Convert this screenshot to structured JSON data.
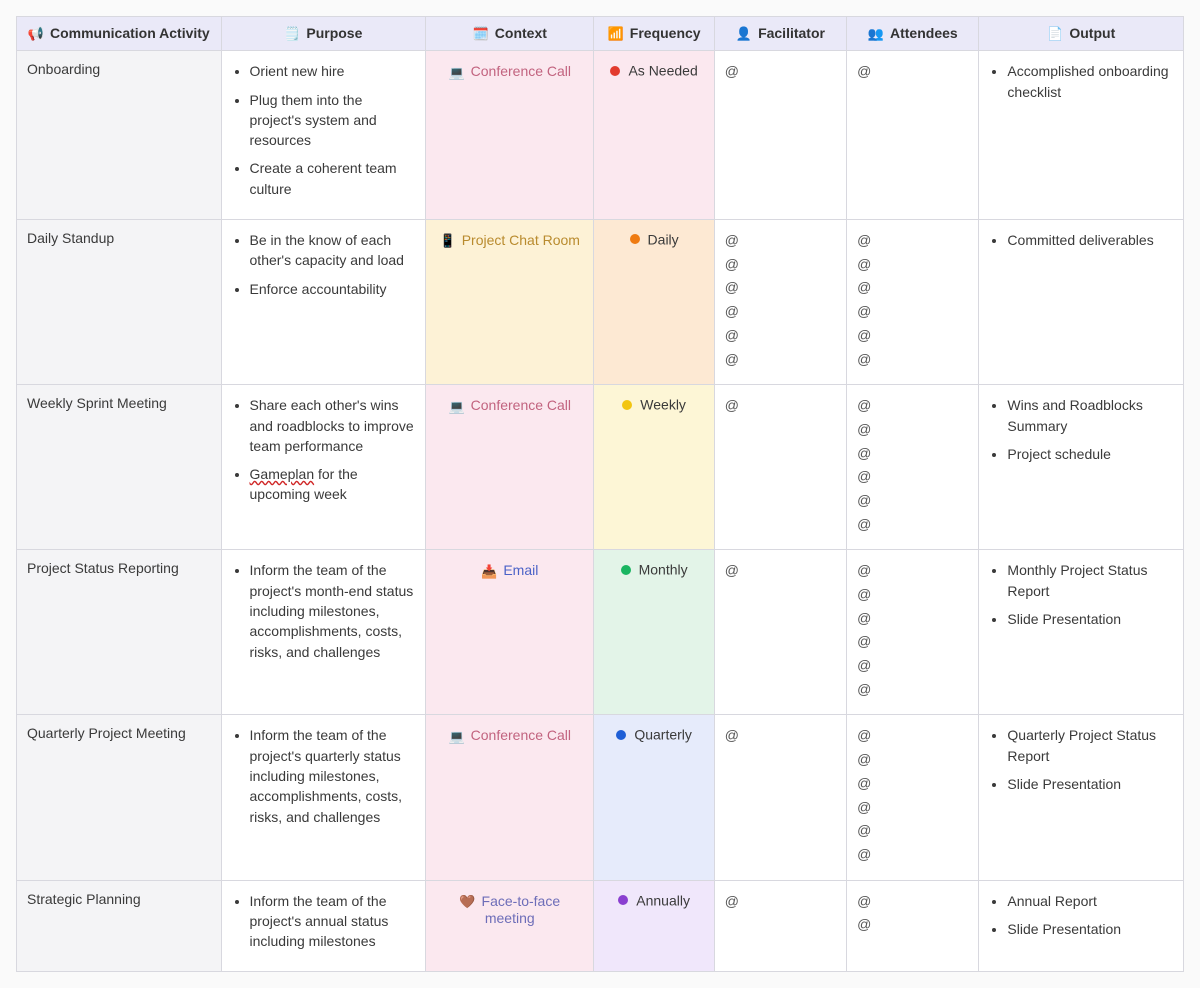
{
  "headers": {
    "activity": {
      "icon": "📢",
      "label": "Communication Activity"
    },
    "purpose": {
      "icon": "🗒️",
      "label": "Purpose"
    },
    "context": {
      "icon": "🗓️",
      "label": "Context"
    },
    "frequency": {
      "icon": "📶",
      "label": "Frequency"
    },
    "facilitator": {
      "icon": "👤",
      "label": "Facilitator"
    },
    "attendees": {
      "icon": "👥",
      "label": "Attendees"
    },
    "output": {
      "icon": "📄",
      "label": "Output"
    }
  },
  "context_styles": {
    "Conference Call": {
      "icon": "💻",
      "text_color": "#c2637f",
      "bg": "#fbe8ef"
    },
    "Project Chat Room": {
      "icon": "📱",
      "text_color": "#b98b2e",
      "bg": "#fdf2d6"
    },
    "Email": {
      "icon": "📥",
      "text_color": "#4b62c7",
      "bg": "#fbe8ef"
    },
    "Face-to-face meeting": {
      "icon": "🤎",
      "text_color": "#6d6db8",
      "bg": "#fbe8ef"
    }
  },
  "frequency_styles": {
    "As Needed": {
      "dot": "#e23b2e",
      "bg": "#fbe8ef"
    },
    "Daily": {
      "dot": "#ef7b11",
      "bg": "#fde9d3"
    },
    "Weekly": {
      "dot": "#f2c511",
      "bg": "#fdf6d6"
    },
    "Monthly": {
      "dot": "#1ab561",
      "bg": "#e3f4e8"
    },
    "Quarterly": {
      "dot": "#1f5fd6",
      "bg": "#e6ebfb"
    },
    "Annually": {
      "dot": "#8a3fd0",
      "bg": "#f0e7fb"
    }
  },
  "rows": [
    {
      "activity": "Onboarding",
      "purpose": [
        "Orient new hire",
        "Plug them into the project's system and resources",
        "Create a coherent team culture"
      ],
      "context": "Conference Call",
      "frequency": "As Needed",
      "facilitator_count": 1,
      "attendees_count": 1,
      "output": [
        "Accomplished onboarding checklist"
      ]
    },
    {
      "activity": "Daily Standup",
      "purpose": [
        "Be in the know of each other's capacity and load",
        "Enforce accountability"
      ],
      "context": "Project Chat Room",
      "frequency": "Daily",
      "facilitator_count": 6,
      "attendees_count": 6,
      "output": [
        "Committed deliverables"
      ]
    },
    {
      "activity": "Weekly Sprint Meeting",
      "purpose": [
        "Share each other's wins and roadblocks to improve team performance",
        "{spell:Gameplan} for the upcoming week"
      ],
      "context": "Conference Call",
      "frequency": "Weekly",
      "facilitator_count": 1,
      "attendees_count": 6,
      "output": [
        "Wins and Roadblocks Summary",
        "Project schedule"
      ]
    },
    {
      "activity": "Project Status Reporting",
      "purpose": [
        "Inform the team of the project's month-end status including milestones, accomplishments, costs, risks, and challenges"
      ],
      "context": "Email",
      "frequency": "Monthly",
      "facilitator_count": 1,
      "attendees_count": 6,
      "output": [
        "Monthly Project Status Report",
        "Slide Presentation"
      ]
    },
    {
      "activity": "Quarterly Project Meeting",
      "purpose": [
        "Inform the team of the project's quarterly status including milestones, accomplishments, costs, risks, and challenges"
      ],
      "context": "Conference Call",
      "frequency": "Quarterly",
      "facilitator_count": 1,
      "attendees_count": 6,
      "output": [
        "Quarterly Project Status Report",
        "Slide Presentation"
      ]
    },
    {
      "activity": "Strategic Planning",
      "purpose": [
        "Inform the team of the project's annual status including milestones"
      ],
      "context": "Face-to-face meeting",
      "frequency": "Annually",
      "facilitator_count": 1,
      "attendees_count": 2,
      "output": [
        "Annual Report",
        "Slide Presentation"
      ]
    }
  ]
}
